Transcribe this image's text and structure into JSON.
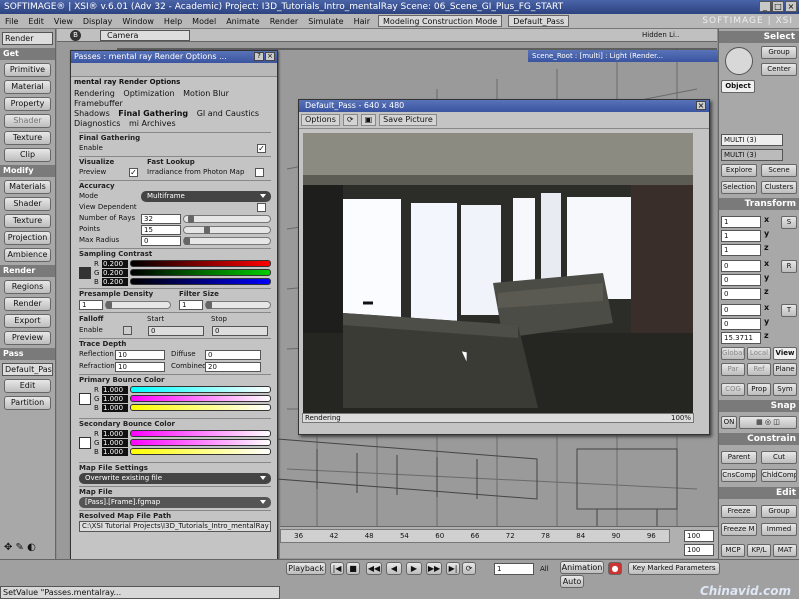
{
  "titlebar": {
    "text": "SOFTIMAGE® | XSI® v.6.01 (Adv 32 - Academic) Project: I3D_Tutorials_Intro_mentalRay    Scene: 06_Scene_GI_Plus_FG_START"
  },
  "menu": {
    "items": [
      "File",
      "Edit",
      "View",
      "Display",
      "Window",
      "Help",
      "Model",
      "Animate",
      "Render",
      "Simulate",
      "Hair"
    ],
    "layout": "Modeling Construction Mode",
    "pass": "Default_Pass",
    "brand": "SOFTIMAGE | XSI"
  },
  "left": {
    "mode": "Render",
    "get": {
      "label": "Get",
      "items": [
        "Primitive",
        "Material",
        "Property",
        "Shader",
        "Texture",
        "Clip"
      ]
    },
    "modify": {
      "label": "Modify",
      "items": [
        "Materials",
        "Shader",
        "Texture",
        "Projection",
        "Ambience"
      ]
    },
    "render": {
      "label": "Render",
      "items": [
        "Regions",
        "Render",
        "Export",
        "Preview"
      ]
    },
    "pass": {
      "label": "Pass",
      "combo": "Default_Pas",
      "items": [
        "Edit",
        "Partition"
      ]
    }
  },
  "viewport": {
    "label": "B",
    "camera": "Camera",
    "hidden": "Hidden Li..",
    "scene_root": "Scene_Root : [multi] : Light (Render..."
  },
  "passes": {
    "title": "Passes : mental ray Render Options ...",
    "header": "mental ray Render Options",
    "tabs": [
      "Rendering",
      "Optimization",
      "Motion Blur",
      "Framebuffer",
      "Shadows",
      "Final Gathering",
      "GI and Caustics",
      "Diagnostics",
      "mi Archives"
    ],
    "fg": {
      "title": "Final Gathering",
      "enable": "Enable"
    },
    "visualize": {
      "title": "Visualize",
      "preview": "Preview"
    },
    "fast": {
      "title": "Fast Lookup",
      "irr": "Irradiance from Photon Map"
    },
    "accuracy": {
      "title": "Accuracy",
      "mode_label": "Mode",
      "mode": "Multiframe",
      "view_dep": "View Dependent",
      "rays_label": "Number of Rays",
      "rays": "32",
      "points_label": "Points",
      "points": "15",
      "maxr_label": "Max Radius",
      "maxr": "0"
    },
    "sampling": {
      "title": "Sampling Contrast",
      "r": "0.200",
      "g": "0.200",
      "b": "0.200"
    },
    "presample": {
      "title": "Presample Density",
      "value": "1"
    },
    "filter": {
      "title": "Filter Size",
      "value": "1"
    },
    "falloff": {
      "title": "Falloff",
      "enable": "Enable",
      "start": "Start",
      "stop": "Stop",
      "start_val": "0",
      "stop_val": "0"
    },
    "trace": {
      "title": "Trace Depth",
      "refl_label": "Reflection",
      "refl": "10",
      "diff_label": "Diffuse",
      "diff": "0",
      "refr_label": "Refraction",
      "refr": "10",
      "comb_label": "Combined",
      "comb": "20"
    },
    "primary": {
      "title": "Primary Bounce Color",
      "r": "1.000",
      "g": "1.000",
      "b": "1.000"
    },
    "secondary": {
      "title": "Secondary Bounce Color",
      "r": "1.000",
      "g": "1.000",
      "b": "1.000"
    },
    "mapfile": {
      "title": "Map File Settings",
      "mode": "Overwrite existing file",
      "file_title": "Map File",
      "file": "[Pass].[Frame].fgmap",
      "resolved_title": "Resolved Map File Path",
      "resolved": "C:\\XSI Tutorial Projects\\I3D_Tutorials_Intro_mentalRay"
    }
  },
  "render": {
    "title": "Default_Pass - 640 x 480",
    "options": "Options",
    "save": "Save Picture",
    "status": "Rendering",
    "percent": "100%"
  },
  "right": {
    "select": "Select",
    "group": "Group",
    "center": "Center",
    "object": "Object",
    "multi1": "MULTI (3)",
    "multi2": "MULTI (3)",
    "explore": "Explore",
    "scene": "Scene",
    "selection": "Selection",
    "clusters": "Clusters",
    "transform": "Transform",
    "s_vals": [
      "1",
      "1",
      "1"
    ],
    "r_vals": [
      "0",
      "0",
      "0"
    ],
    "t_vals": [
      "0",
      "0",
      "15.3711"
    ],
    "s": "S",
    "r": "R",
    "t": "T",
    "x": "x",
    "y": "y",
    "z": "z",
    "global": "Global",
    "local": "Local",
    "view": "View",
    "par": "Par",
    "ref": "Ref",
    "plane": "Plane",
    "cog": "COG",
    "prop": "Prop",
    "sym": "Sym",
    "snap": "Snap",
    "on": "ON",
    "constrain": "Constrain",
    "parent": "Parent",
    "cut": "Cut",
    "cnscomp": "CnsComp",
    "childcomp": "ChldComp",
    "edit": "Edit",
    "freeze": "Freeze",
    "group2": "Group",
    "freezem": "Freeze M",
    "immed": "Immed",
    "mcp": "MCP",
    "kpl": "KP/L",
    "mat": "MAT"
  },
  "timeline": {
    "ticks": [
      "36",
      "42",
      "48",
      "54",
      "60",
      "66",
      "72",
      "78",
      "84",
      "90",
      "96"
    ],
    "end1": "100",
    "end2": "100",
    "start": "1"
  },
  "bottom": {
    "playback": "Playback",
    "frame": "1",
    "all": "All",
    "animation": "Animation",
    "auto": "Auto",
    "kmp": "Key Marked Parameters",
    "status": "SetValue \"Passes.mentalray..."
  },
  "watermark": "Chinavid.com"
}
